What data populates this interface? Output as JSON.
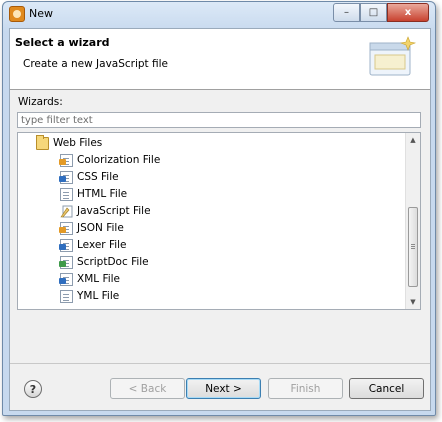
{
  "window": {
    "title": "New",
    "controls": {
      "minimize": "–",
      "maximize": "□",
      "close": "x"
    }
  },
  "header": {
    "title": "Select a wizard",
    "description": "Create a new JavaScript file"
  },
  "wizards": {
    "label": "Wizards:",
    "filter_placeholder": "type filter text"
  },
  "tree": {
    "folder": {
      "label": "Web Files",
      "icon": "folder-open-icon"
    },
    "items": [
      {
        "label": "Colorization File",
        "icon": "colorization-file-icon"
      },
      {
        "label": "CSS File",
        "icon": "css-file-icon"
      },
      {
        "label": "HTML File",
        "icon": "html-file-icon"
      },
      {
        "label": "JavaScript File",
        "icon": "javascript-file-icon",
        "selected": true
      },
      {
        "label": "JSON File",
        "icon": "json-file-icon"
      },
      {
        "label": "Lexer File",
        "icon": "lexer-file-icon"
      },
      {
        "label": "ScriptDoc File",
        "icon": "scriptdoc-file-icon"
      },
      {
        "label": "XML File",
        "icon": "xml-file-icon"
      },
      {
        "label": "YML File",
        "icon": "yml-file-icon"
      }
    ]
  },
  "buttons": {
    "help": "?",
    "back": "< Back",
    "next": "Next >",
    "finish": "Finish",
    "cancel": "Cancel"
  },
  "colors": {
    "accent": "#3c7fb1",
    "title_bg": "#c7d9ee",
    "close": "#c8422f"
  }
}
